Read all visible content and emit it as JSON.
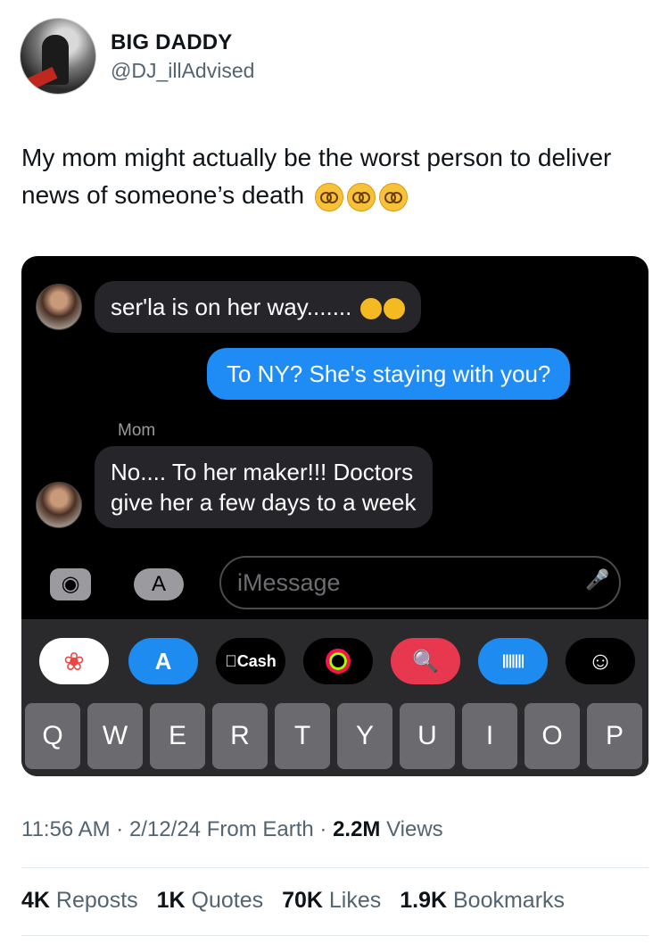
{
  "tweet": {
    "display_name": "BIG DADDY",
    "handle": "@DJ_illAdvised",
    "text": "My mom might actually be the worst person to deliver news of someone’s death",
    "emoji_icon": "dizzy-face-emoji"
  },
  "conversation": {
    "incoming_1": "ser'la is on her way.......",
    "outgoing_1": "To NY? She's staying with you?",
    "sender_label": "Mom",
    "incoming_2_line1": "No.... To her maker!!! Doctors",
    "incoming_2_line2": "give her a few days to a week"
  },
  "input": {
    "placeholder": "iMessage"
  },
  "apps_tray": {
    "items": [
      "photos-icon",
      "app-store-icon",
      "Cash",
      "fitness-icon",
      "search-images-icon",
      "audio-message-icon",
      "memoji-icon"
    ],
    "cash_label": "Cash"
  },
  "keyboard": {
    "keys": [
      "Q",
      "W",
      "E",
      "R",
      "T",
      "Y",
      "U",
      "I",
      "O",
      "P"
    ]
  },
  "meta": {
    "time": "11:56 AM",
    "date": "2/12/24",
    "source": "From Earth",
    "views_count": "2.2M",
    "views_label": "Views"
  },
  "stats": {
    "reposts_count": "4K",
    "reposts_label": "Reposts",
    "quotes_count": "1K",
    "quotes_label": "Quotes",
    "likes_count": "70K",
    "likes_label": "Likes",
    "bookmarks_count": "1.9K",
    "bookmarks_label": "Bookmarks"
  },
  "colors": {
    "bubble_outgoing": "#1f8bf5",
    "bubble_incoming": "#26252a",
    "emoji": "#f7c23a"
  }
}
